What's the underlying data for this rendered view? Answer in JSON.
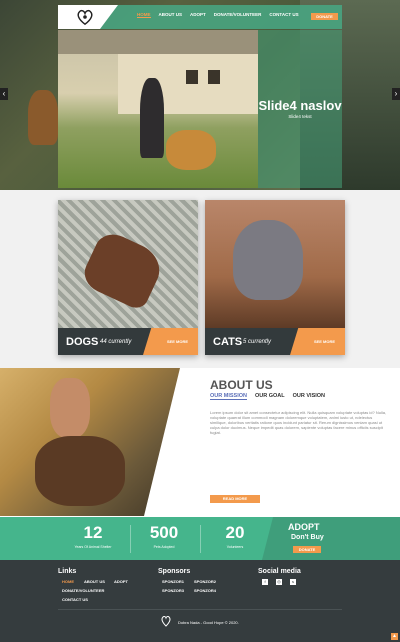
{
  "nav": {
    "items": [
      "HOME",
      "ABOUT US",
      "ADOPT",
      "DONATE/VOLUNTEER",
      "CONTACT US"
    ],
    "donate": "DONATE"
  },
  "hero": {
    "title": "Slide4 naslov",
    "subtitle": "Slide4 tekst",
    "arrow_left": "‹",
    "arrow_right": "›"
  },
  "pets": {
    "dogs": {
      "title": "DOGS",
      "count": "44 currently",
      "button": "SEE MORE"
    },
    "cats": {
      "title": "CATS",
      "count": "5 currently",
      "button": "SEE MORE"
    }
  },
  "about": {
    "title": "ABOUT US",
    "tabs": [
      "OUR MISSION",
      "OUR GOAL",
      "OUR VISION"
    ],
    "text": "Lorem ipsum dolor sit amet consectetur adipiscing elit. Nulla quisquam voluptate voluptas id? Nulla, voluptate quaerat illum commodi magnam doloremque voluptatem, animi iusto ut, ndelectus similique, doloribus veritatis ratione quos incidunt pariatur sit. Rerum dignissimos veniam quasi ut culpa dolor ducimus. Neque impedit quas dolorem, sapiente voluptas facere minus officiis suscipit fugiat.",
    "button": "READ MORE"
  },
  "stats": [
    {
      "value": "12",
      "label": "Years Of Animal Shelter"
    },
    {
      "value": "500",
      "label": "Pets Adopted"
    },
    {
      "value": "20",
      "label": "Volunteers"
    }
  ],
  "adopt": {
    "title": "ADOPT",
    "subtitle": "Don't Buy",
    "button": "DONATE"
  },
  "footer": {
    "links_title": "Links",
    "links": [
      "HOME",
      "ABOUT US",
      "ADOPT",
      "DONATE/VOLUNTEER",
      "CONTACT US"
    ],
    "sponsors_title": "Sponsors",
    "sponsors": [
      "SPONZOR1",
      "SPONZOR2",
      "SPONZOR3",
      "SPONZOR4"
    ],
    "social_title": "Social media",
    "social_icons": [
      "facebook-icon",
      "instagram-icon",
      "skype-icon"
    ],
    "copyright": "Dobra Nada - Good Hope © 2020."
  },
  "colors": {
    "accent": "#f39a4c",
    "green": "#45b58c",
    "dark": "#353c3e"
  }
}
